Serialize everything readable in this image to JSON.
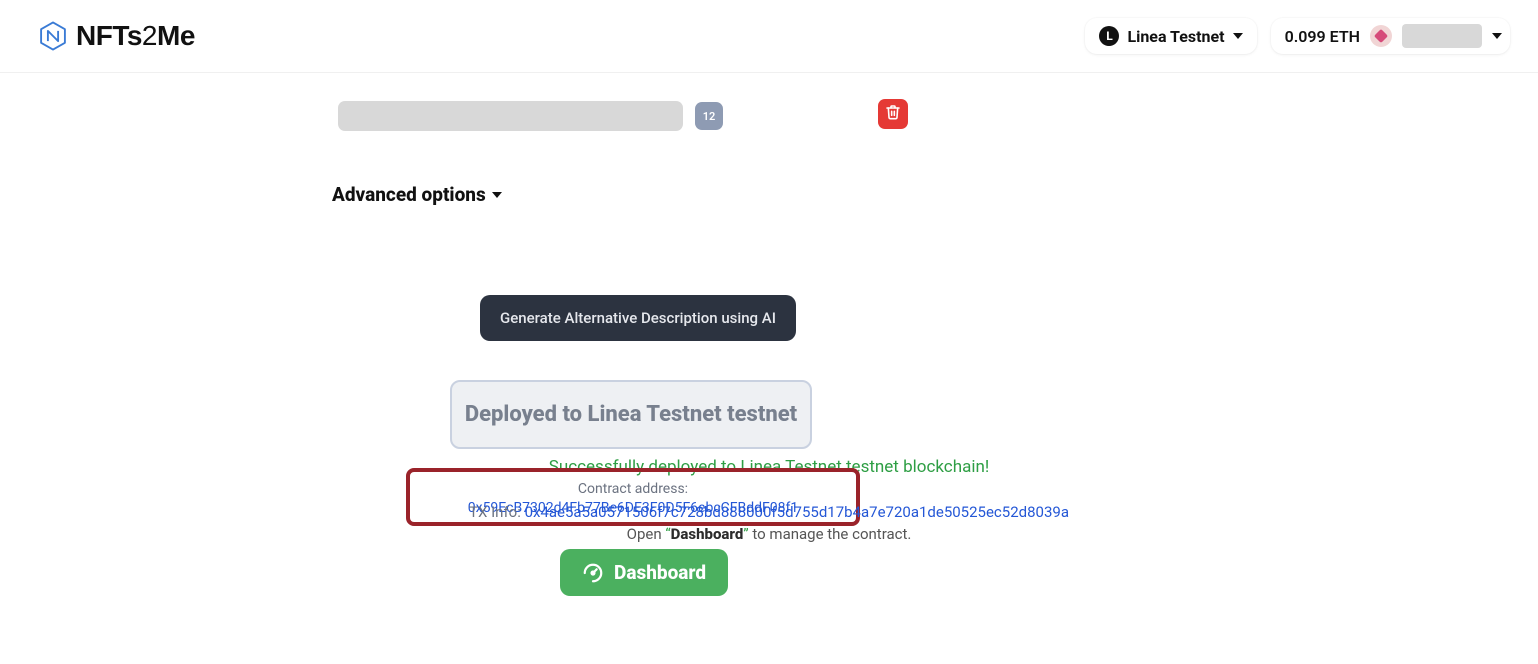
{
  "header": {
    "logo_text": "NFTs2Me",
    "network_label": "Linea Testnet",
    "balance": "0.099 ETH"
  },
  "form": {
    "count_badge": "12",
    "advanced_label": "Advanced options"
  },
  "actions": {
    "generate_ai_label": "Generate Alternative Description using AI",
    "deployed_box_label": "Deployed to Linea Testnet testnet",
    "dashboard_button_label": "Dashboard"
  },
  "status": {
    "success_line": "Successfully deployed to Linea Testnet testnet blockchain!",
    "contract_label": "Contract address: ",
    "contract_address": "0x59EcB7302d4Fb77Be6DE3F0D5F6ebcCFBddF08f1",
    "tx_label": "TX Info: ",
    "tx_hash": "0x4ae5a5a0571506f7c728bd888000f5d755d17b4a7e720a1de50525ec52d8039a",
    "open_dash_pre": "Open ",
    "open_dash_q1": "“",
    "open_dash_word": "Dashboard",
    "open_dash_q2": "”",
    "open_dash_post": " to manage the contract."
  }
}
